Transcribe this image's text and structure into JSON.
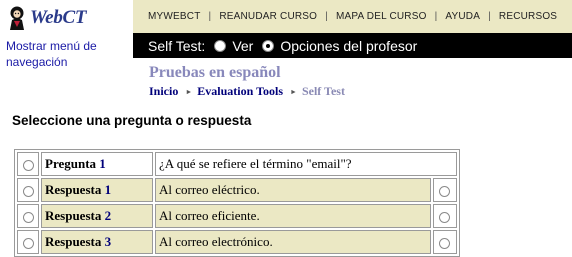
{
  "app": {
    "logo_text": "WebCT",
    "nav_toggle": "Mostrar menú de navegación"
  },
  "top_menu": {
    "items": [
      "MYWEBCT",
      "REANUDAR CURSO",
      "MAPA DEL CURSO",
      "AYUDA",
      "RECURSOS"
    ],
    "separator": "|"
  },
  "selftest_bar": {
    "label": "Self Test:",
    "options": [
      {
        "label": "Ver",
        "selected": false
      },
      {
        "label": "Opciones del profesor",
        "selected": true
      }
    ]
  },
  "course": {
    "title": "Pruebas en español"
  },
  "breadcrumb": {
    "items": [
      "Inicio",
      "Evaluation Tools",
      "Self Test"
    ],
    "current": "Self Test"
  },
  "page": {
    "heading": "Seleccione una pregunta o respuesta"
  },
  "qa_table": {
    "question": {
      "label": "Pregunta",
      "number": "1",
      "text": "¿A qué se refiere el término \"email\"?",
      "selected": false
    },
    "answers": [
      {
        "label": "Respuesta",
        "number": "1",
        "text": "Al correo eléctrico.",
        "selected_left": false,
        "selected_right": false
      },
      {
        "label": "Respuesta",
        "number": "2",
        "text": "Al correo eficiente.",
        "selected_left": false,
        "selected_right": false
      },
      {
        "label": "Respuesta",
        "number": "3",
        "text": "Al correo electrónico.",
        "selected_left": false,
        "selected_right": false
      }
    ]
  },
  "colors": {
    "menu_bg": "#ebe8c4",
    "bar_bg": "#000000",
    "answer_bg": "#ebe8c4",
    "link": "#00007a",
    "course_title": "#8888bb"
  }
}
